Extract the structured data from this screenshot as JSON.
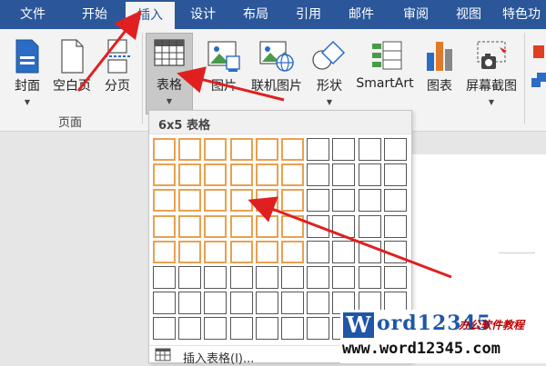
{
  "ribbon_tabs": [
    "文件",
    "开始",
    "插入",
    "设计",
    "布局",
    "引用",
    "邮件",
    "审阅",
    "视图",
    "特色功"
  ],
  "active_tab": "插入",
  "buttons": {
    "cover": "封面",
    "blank_page": "空白页",
    "page_break": "分页",
    "table": "表格",
    "picture": "图片",
    "online_picture": "联机图片",
    "shapes": "形状",
    "smartart": "SmartArt",
    "chart": "图表",
    "screenshot": "屏幕截图"
  },
  "group_label": "页面",
  "table_dropdown": {
    "title": "6x5 表格",
    "grid_cols": 10,
    "grid_rows": 8,
    "selected_cols": 6,
    "selected_rows": 5,
    "insert_table": "插入表格(I)..."
  },
  "watermark": {
    "w_letter": "W",
    "title": "ord12345",
    "subtitle": "办公软件教程",
    "url": "www.word12345.com"
  },
  "colors": {
    "brand": "#2b579a",
    "highlight_cell": "#e8a150",
    "arrow": "#e02020"
  }
}
